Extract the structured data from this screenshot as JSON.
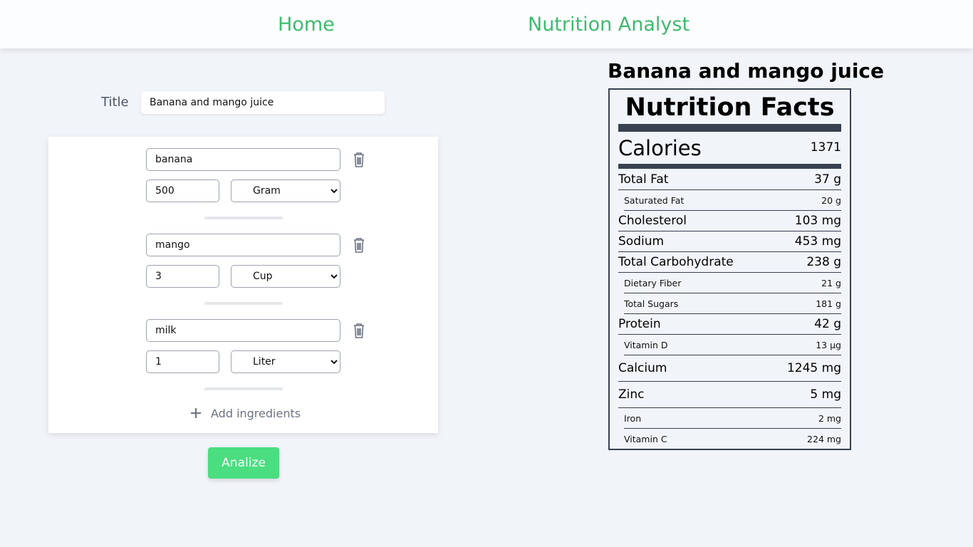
{
  "nav": {
    "home": "Home",
    "analyst": "Nutrition Analyst"
  },
  "form": {
    "title_label": "Title",
    "title_value": "Banana and mango juice",
    "ingredients": [
      {
        "name": "banana",
        "quantity": "500",
        "unit": "Gram"
      },
      {
        "name": "mango",
        "quantity": "3",
        "unit": "Cup"
      },
      {
        "name": "milk",
        "quantity": "1",
        "unit": "Liter"
      }
    ],
    "add_label": "Add ingredients",
    "analyze_label": "Analize"
  },
  "result": {
    "title": "Banana and mango juice",
    "heading": "Nutrition Facts",
    "calories_label": "Calories",
    "calories_value": "1371",
    "rows": [
      {
        "label": "Total Fat",
        "value": "37 g",
        "level": "main"
      },
      {
        "label": "Saturated Fat",
        "value": "20 g",
        "level": "sub"
      },
      {
        "label": "Cholesterol",
        "value": "103 mg",
        "level": "main"
      },
      {
        "label": "Sodium",
        "value": "453 mg",
        "level": "main"
      },
      {
        "label": "Total Carbohydrate",
        "value": "238 g",
        "level": "main"
      },
      {
        "label": "Dietary Fiber",
        "value": "21 g",
        "level": "sub"
      },
      {
        "label": "Total Sugars",
        "value": "181 g",
        "level": "sub"
      },
      {
        "label": "Protein",
        "value": "42 g",
        "level": "main"
      },
      {
        "label": "Vitamin D",
        "value": "13 µg",
        "level": "sub"
      },
      {
        "label": "Calcium",
        "value": "1245 mg",
        "level": "main"
      },
      {
        "label": "Zinc",
        "value": "5 mg",
        "level": "main"
      },
      {
        "label": "Iron",
        "value": "2 mg",
        "level": "sub"
      },
      {
        "label": "Vitamin C",
        "value": "224 mg",
        "level": "sub"
      }
    ]
  },
  "colors": {
    "accent": "#3dbb6e",
    "button": "#4ade80",
    "border": "#374151",
    "background": "#f1f4f9"
  }
}
